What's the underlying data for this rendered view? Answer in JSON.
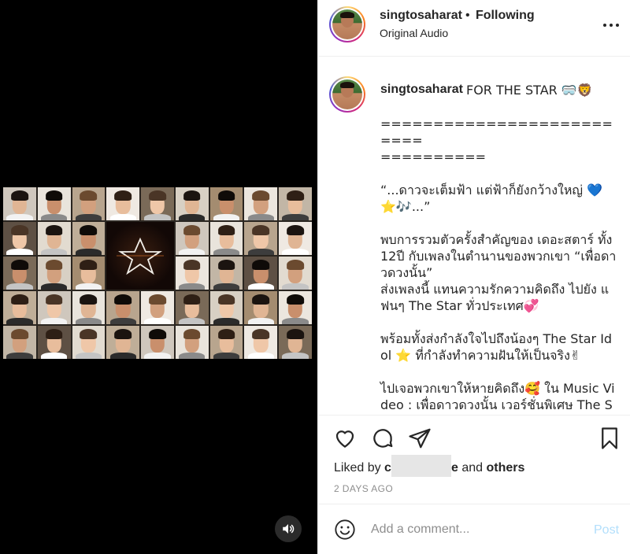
{
  "colors": {
    "text": "#262626",
    "muted": "#8e8e8e",
    "post_disabled": "#b2dffc",
    "like_emoji": "#d62976",
    "heart_blue": "#3897f0"
  },
  "media": {
    "sound_icon": "volume-icon"
  },
  "header": {
    "username": "singtosaharat",
    "separator": "•",
    "follow_status": "Following",
    "audio": "Original Audio",
    "more_icon": "more-horizontal-icon"
  },
  "caption": {
    "username": "singtosaharat",
    "first_line": "FOR THE STAR 🥽🦁",
    "body": "==========================\n==========\n\n“...ดาวจะเต็มฟ้า แต่ฟ้าก็ยังกว้างใหญ่ 💙⭐🎶...”\n\nพบการรวมตัวครั้งสำคัญของ เดอะสตาร์ ทั้ง12ปี กับเพลงในตำนานของพวกเขา “เพื่อดาวดวงนั้น”\nส่งเพลงนี้ แทนความรักความคิดถึง ไปยัง แฟนๆ The Star ทั่วประเทศ💞\n\nพร้อมทั้งส่งกำลังใจไปถึงน้องๆ The Star Idol ⭐ ที่กำลังทำความฝันให้เป็นจริง✌\n\nไปเจอพวกเขาให้หายคิดถึง🥰 ใน Music Video : เพื่อดาวดวงนั้น เวอร์ชั่นพิเศษ The Star From Home"
  },
  "actions": {
    "like_icon": "heart-icon",
    "comment_icon": "comment-icon",
    "share_icon": "share-icon",
    "save_icon": "bookmark-icon"
  },
  "likes": {
    "prefix": "Liked by",
    "user_start": "c",
    "user_end": "e",
    "connector": "and",
    "others": "others"
  },
  "time_ago": "2 DAYS AGO",
  "comment": {
    "emoji_icon": "smiley-icon",
    "placeholder": "Add a comment...",
    "post_label": "Post"
  }
}
